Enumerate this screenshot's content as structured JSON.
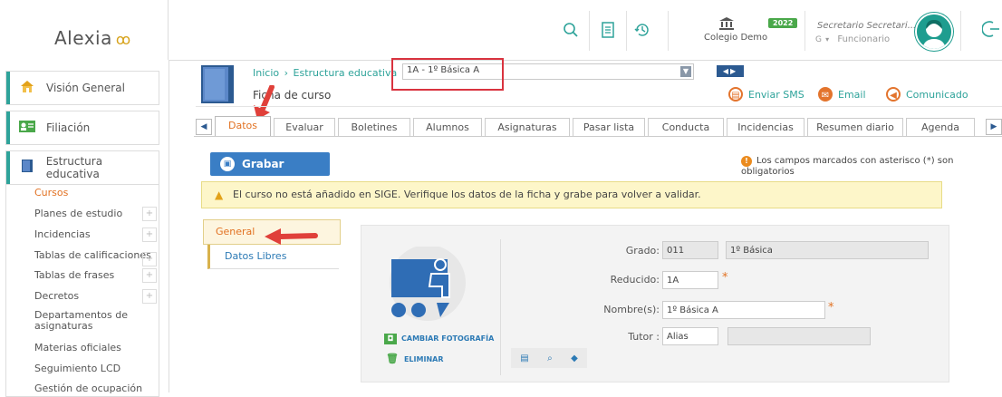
{
  "app": {
    "logo_text": "Alexia",
    "logo_mark": "ꝏ"
  },
  "topbar": {
    "icons": [
      "search-icon",
      "document-icon",
      "history-icon"
    ],
    "school_name": "Colegio Demo",
    "year": "2022",
    "user_name": "Secretario Secretari...",
    "user_role": "Funcionario",
    "user_role_prefix": "G",
    "logout_icon": "logout-icon"
  },
  "sidebar": {
    "main_items": [
      {
        "label": "Visión General",
        "icon": "home-icon"
      },
      {
        "label": "Filiación",
        "icon": "filiation-icon"
      },
      {
        "label": "Estructura educativa",
        "icon": "structure-icon"
      }
    ],
    "sub_items": [
      {
        "label": "Cursos",
        "active": true,
        "expandable": false
      },
      {
        "label": "Planes de estudio",
        "expandable": true
      },
      {
        "label": "Incidencias",
        "expandable": true
      },
      {
        "label": "Tablas de calificaciones",
        "expandable": true
      },
      {
        "label": "Tablas de frases",
        "expandable": true
      },
      {
        "label": "Decretos",
        "expandable": true
      },
      {
        "label": "Departamentos de asignaturas",
        "expandable": false
      },
      {
        "label": "Materias oficiales",
        "expandable": false
      },
      {
        "label": "Seguimiento LCD",
        "expandable": false
      },
      {
        "label": "Gestión de ocupación",
        "expandable": false
      }
    ],
    "plus_symbol": "+"
  },
  "header": {
    "breadcrumb": [
      "Inicio",
      "Estructura educativa"
    ],
    "breadcrumb_sep": "›",
    "course_select": "1A - 1º Básica A",
    "subtitle": "Ficha de curso",
    "actions": [
      {
        "label": "Enviar SMS",
        "icon": "sms-icon"
      },
      {
        "label": "Email",
        "icon": "email-icon"
      },
      {
        "label": "Comunicado",
        "icon": "megaphone-icon"
      }
    ]
  },
  "tabs": [
    "Datos",
    "Evaluar",
    "Boletines",
    "Alumnos",
    "Asignaturas",
    "Pasar lista",
    "Conducta",
    "Incidencias",
    "Resumen diario",
    "Agenda"
  ],
  "active_tab": "Datos",
  "content": {
    "save_button": "Grabar",
    "required_note": "Los campos marcados con asterisco (*) son obligatorios",
    "warning": "El curso no está añadido en SIGE. Verifique los datos de la ficha y grabe para volver a validar.",
    "side_tabs": [
      "General",
      "Datos Libres"
    ],
    "change_photo": "CAMBIAR FOTOGRAFÍA",
    "delete_photo": "ELIMINAR",
    "form": {
      "grado_label": "Grado:",
      "grado_code": "011",
      "grado_name": "1º Básica",
      "reducido_label": "Reducido:",
      "reducido_value": "1A",
      "nombre_label": "Nombre(s):",
      "nombre_value": "1º Básica A",
      "tutor_label": "Tutor :",
      "tutor_placeholder": "Alias",
      "required_mark": "*"
    }
  },
  "colors": {
    "accent": "#2ea39a",
    "active_tab": "#e27223",
    "save_button": "#3a7ec5",
    "warning_bg": "#fdf6c9",
    "highlight": "#d9333f"
  }
}
